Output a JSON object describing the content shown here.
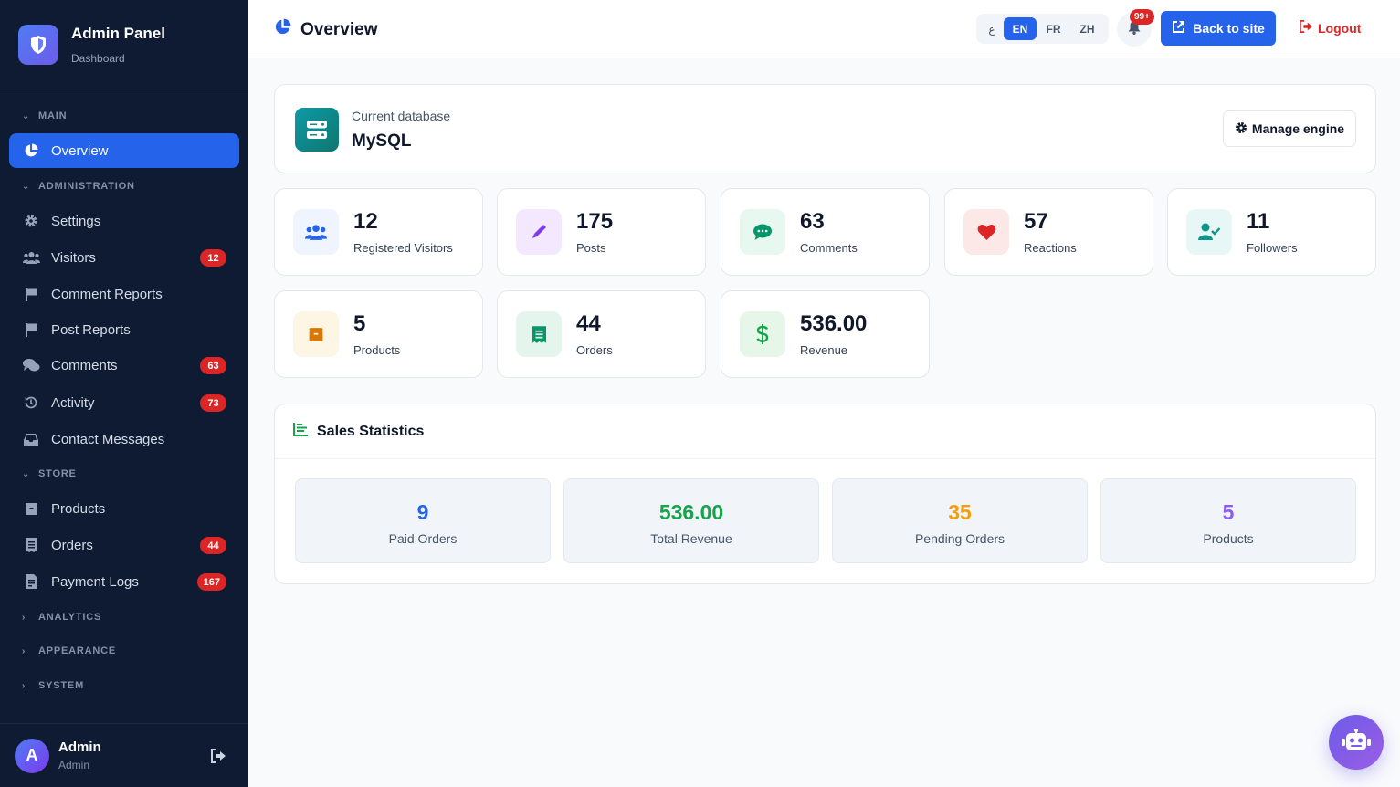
{
  "brand": {
    "title": "Admin Panel",
    "subtitle": "Dashboard"
  },
  "sidebar": {
    "groups": {
      "main": "MAIN",
      "administration": "ADMINISTRATION",
      "store": "STORE",
      "analytics": "ANALYTICS",
      "appearance": "APPEARANCE",
      "system": "SYSTEM"
    },
    "items": {
      "overview": "Overview",
      "settings": "Settings",
      "visitors": "Visitors",
      "visitors_badge": "12",
      "comment_reports": "Comment Reports",
      "post_reports": "Post Reports",
      "comments": "Comments",
      "comments_badge": "63",
      "activity": "Activity",
      "activity_badge": "73",
      "contact_messages": "Contact Messages",
      "products": "Products",
      "orders": "Orders",
      "orders_badge": "44",
      "payment_logs": "Payment Logs",
      "payment_logs_badge": "167"
    },
    "user": {
      "initial": "A",
      "name": "Admin",
      "role": "Admin"
    }
  },
  "header": {
    "title": "Overview",
    "languages": {
      "first": "ع",
      "en": "EN",
      "fr": "FR",
      "zh": "ZH",
      "active": "EN"
    },
    "notifications_badge": "99+",
    "back_to_site": "Back to site",
    "logout": "Logout"
  },
  "database": {
    "label": "Current database",
    "value": "MySQL",
    "manage_label": "Manage engine"
  },
  "stats": [
    {
      "value": "12",
      "label": "Registered Visitors",
      "icon": "users-icon",
      "color": "#2563eb"
    },
    {
      "value": "175",
      "label": "Posts",
      "icon": "pen-icon",
      "color": "#7c3aed"
    },
    {
      "value": "63",
      "label": "Comments",
      "icon": "comment-icon",
      "color": "#059669"
    },
    {
      "value": "57",
      "label": "Reactions",
      "icon": "heart-icon",
      "color": "#dc2626"
    },
    {
      "value": "11",
      "label": "Followers",
      "icon": "user-check-icon",
      "color": "#0d9488"
    },
    {
      "value": "5",
      "label": "Products",
      "icon": "box-icon",
      "color": "#d97706"
    },
    {
      "value": "44",
      "label": "Orders",
      "icon": "receipt-icon",
      "color": "#059669"
    },
    {
      "value": "536.00",
      "label": "Revenue",
      "icon": "dollar-icon",
      "color": "#16a34a"
    }
  ],
  "sales": {
    "title": "Sales Statistics",
    "items": [
      {
        "value": "9",
        "label": "Paid Orders",
        "color": "#2563eb"
      },
      {
        "value": "536.00",
        "label": "Total Revenue",
        "color": "#16a34a"
      },
      {
        "value": "35",
        "label": "Pending Orders",
        "color": "#f59e0b"
      },
      {
        "value": "5",
        "label": "Products",
        "color": "#8b5cf6"
      }
    ]
  }
}
